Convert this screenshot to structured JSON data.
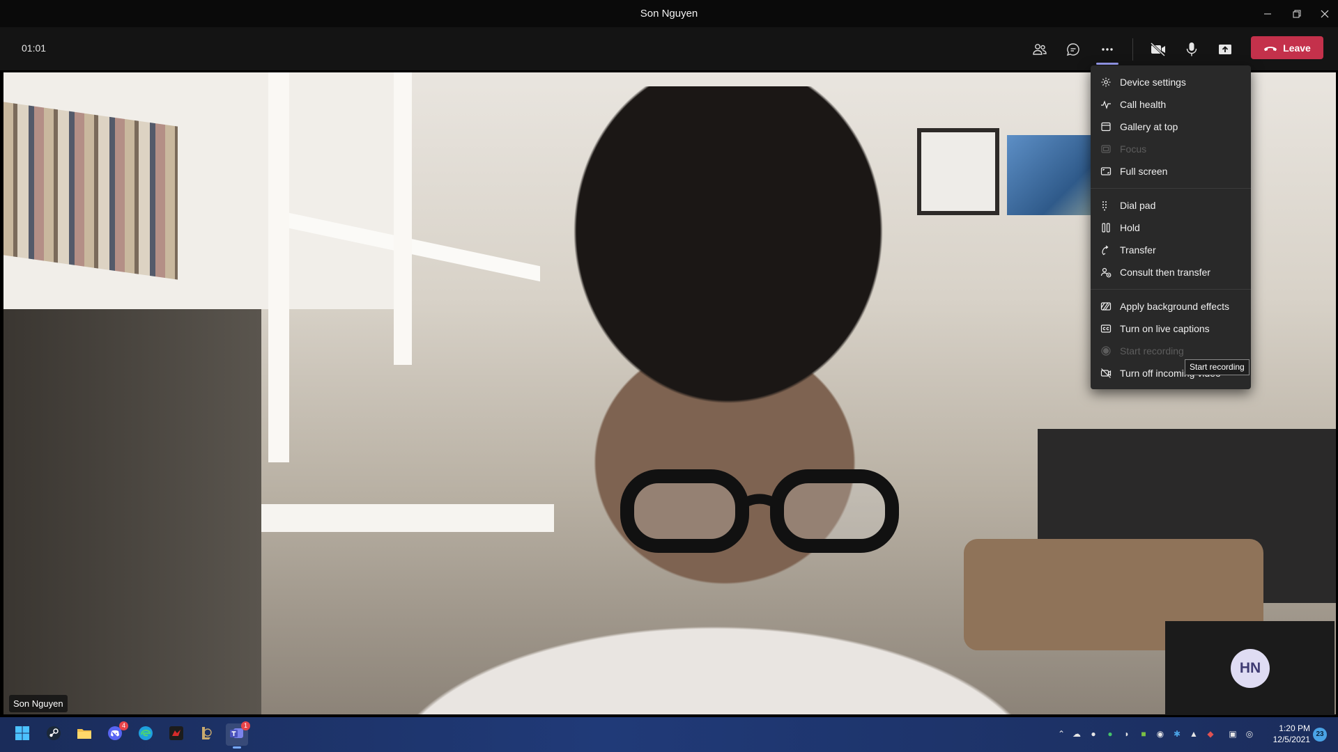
{
  "window": {
    "title": "Son Nguyen",
    "controls": [
      "minimize-icon",
      "restore-icon",
      "close-icon"
    ]
  },
  "toolbar": {
    "timer": "01:01",
    "buttons": [
      "people-icon",
      "chat-icon",
      "more-actions-icon",
      "camera-off-icon",
      "microphone-icon",
      "share-screen-icon"
    ],
    "leave_label": "Leave",
    "leave_color": "#c4314b",
    "active_indicator_color": "#9b9ff5"
  },
  "video": {
    "participant_name": "Son Nguyen"
  },
  "self_view": {
    "initials": "HN"
  },
  "menu": {
    "groups": [
      [
        {
          "label": "Device settings",
          "icon": "gear-icon",
          "disabled": false
        },
        {
          "label": "Call health",
          "icon": "pulse-icon",
          "disabled": false
        },
        {
          "label": "Gallery at top",
          "icon": "gallery-icon",
          "disabled": false
        },
        {
          "label": "Focus",
          "icon": "focus-icon",
          "disabled": true
        },
        {
          "label": "Full screen",
          "icon": "fullscreen-icon",
          "disabled": false
        }
      ],
      [
        {
          "label": "Dial pad",
          "icon": "dialpad-icon",
          "disabled": false
        },
        {
          "label": "Hold",
          "icon": "pause-icon",
          "disabled": false
        },
        {
          "label": "Transfer",
          "icon": "transfer-icon",
          "disabled": false
        },
        {
          "label": "Consult then transfer",
          "icon": "consult-transfer-icon",
          "disabled": false
        }
      ],
      [
        {
          "label": "Apply background effects",
          "icon": "background-effects-icon",
          "disabled": false
        },
        {
          "label": "Turn on live captions",
          "icon": "captions-icon",
          "disabled": false
        },
        {
          "label": "Start recording",
          "icon": "record-icon",
          "disabled": true
        },
        {
          "label": "Turn off incoming video",
          "icon": "video-off-icon",
          "disabled": false
        }
      ]
    ]
  },
  "tooltip": {
    "text": "Start recording"
  },
  "taskbar": {
    "apps": [
      {
        "name": "windows-start-icon",
        "badge": ""
      },
      {
        "name": "steam-icon",
        "badge": ""
      },
      {
        "name": "file-explorer-icon",
        "badge": ""
      },
      {
        "name": "discord-icon",
        "badge": "4"
      },
      {
        "name": "edge-icon",
        "badge": ""
      },
      {
        "name": "msi-dragon-icon",
        "badge": ""
      },
      {
        "name": "league-client-icon",
        "badge": ""
      },
      {
        "name": "teams-icon",
        "badge": "1"
      }
    ],
    "clock_time": "1:20 PM",
    "clock_date": "12/5/2021",
    "notification_count": "23"
  }
}
